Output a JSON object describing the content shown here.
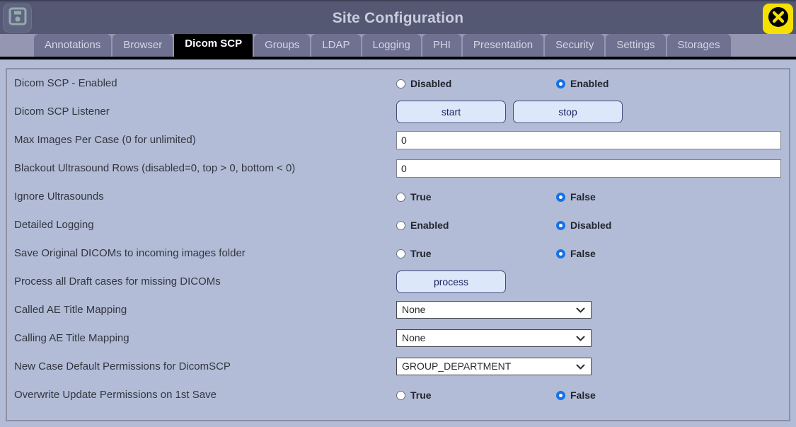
{
  "window": {
    "title": "Site Configuration",
    "save_icon": "floppy-disk-save-icon",
    "close_icon": "close-x-icon"
  },
  "tabs": [
    {
      "label": "Annotations",
      "active": false
    },
    {
      "label": "Browser",
      "active": false
    },
    {
      "label": "Dicom SCP",
      "active": true
    },
    {
      "label": "Groups",
      "active": false
    },
    {
      "label": "LDAP",
      "active": false
    },
    {
      "label": "Logging",
      "active": false
    },
    {
      "label": "PHI",
      "active": false
    },
    {
      "label": "Presentation",
      "active": false
    },
    {
      "label": "Security",
      "active": false
    },
    {
      "label": "Settings",
      "active": false
    },
    {
      "label": "Storages",
      "active": false
    }
  ],
  "rows": {
    "scp_enabled": {
      "label": "Dicom SCP - Enabled",
      "option_a": "Disabled",
      "option_b": "Enabled",
      "selected": "b"
    },
    "scp_listener": {
      "label": "Dicom SCP Listener",
      "start_label": "start",
      "stop_label": "stop"
    },
    "max_images": {
      "label": "Max Images Per Case (0 for unlimited)",
      "value": "0"
    },
    "blackout_rows": {
      "label": "Blackout Ultrasound Rows (disabled=0, top > 0, bottom < 0)",
      "value": "0"
    },
    "ignore_ultrasounds": {
      "label": "Ignore Ultrasounds",
      "option_a": "True",
      "option_b": "False",
      "selected": "b"
    },
    "detailed_logging": {
      "label": "Detailed Logging",
      "option_a": "Enabled",
      "option_b": "Disabled",
      "selected": "b"
    },
    "save_original": {
      "label": "Save Original DICOMs to incoming images folder",
      "option_a": "True",
      "option_b": "False",
      "selected": "b"
    },
    "process_drafts": {
      "label": "Process all Draft cases for missing DICOMs",
      "button_label": "process"
    },
    "called_ae": {
      "label": "Called AE Title Mapping",
      "value": "None"
    },
    "calling_ae": {
      "label": "Calling AE Title Mapping",
      "value": "None"
    },
    "new_case_perms": {
      "label": "New Case Default Permissions for DicomSCP",
      "value": "GROUP_DEPARTMENT"
    },
    "overwrite_perms": {
      "label": "Overwrite Update Permissions on 1st Save",
      "option_a": "True",
      "option_b": "False",
      "selected": "b"
    }
  },
  "colors": {
    "titlebar": "#555873",
    "tabbar": "#9496b2",
    "tab": "#6f7190",
    "active_tab": "#000000",
    "panel": "#b2bcd6",
    "accent_radio": "#1473e6",
    "close_button": "#f5e000",
    "button_fill": "#dde7fa"
  }
}
